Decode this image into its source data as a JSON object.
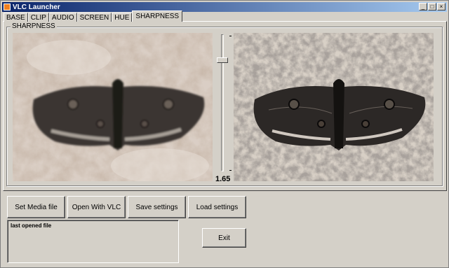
{
  "window": {
    "title": "VLC Launcher"
  },
  "tabs": [
    "BASE",
    "CLIP",
    "AUDIO",
    "SCREEN",
    "HUE",
    "SHARPNESS"
  ],
  "active_tab": "SHARPNESS",
  "sharpness": {
    "group_label": "SHARPNESS",
    "value_text": "1.65"
  },
  "buttons": {
    "set_media": "Set Media file",
    "open_vlc": "Open With VLC",
    "save_settings": "Save settings",
    "load_settings": "Load settings",
    "exit": "Exit"
  },
  "status_box": {
    "text": "last opened file"
  }
}
